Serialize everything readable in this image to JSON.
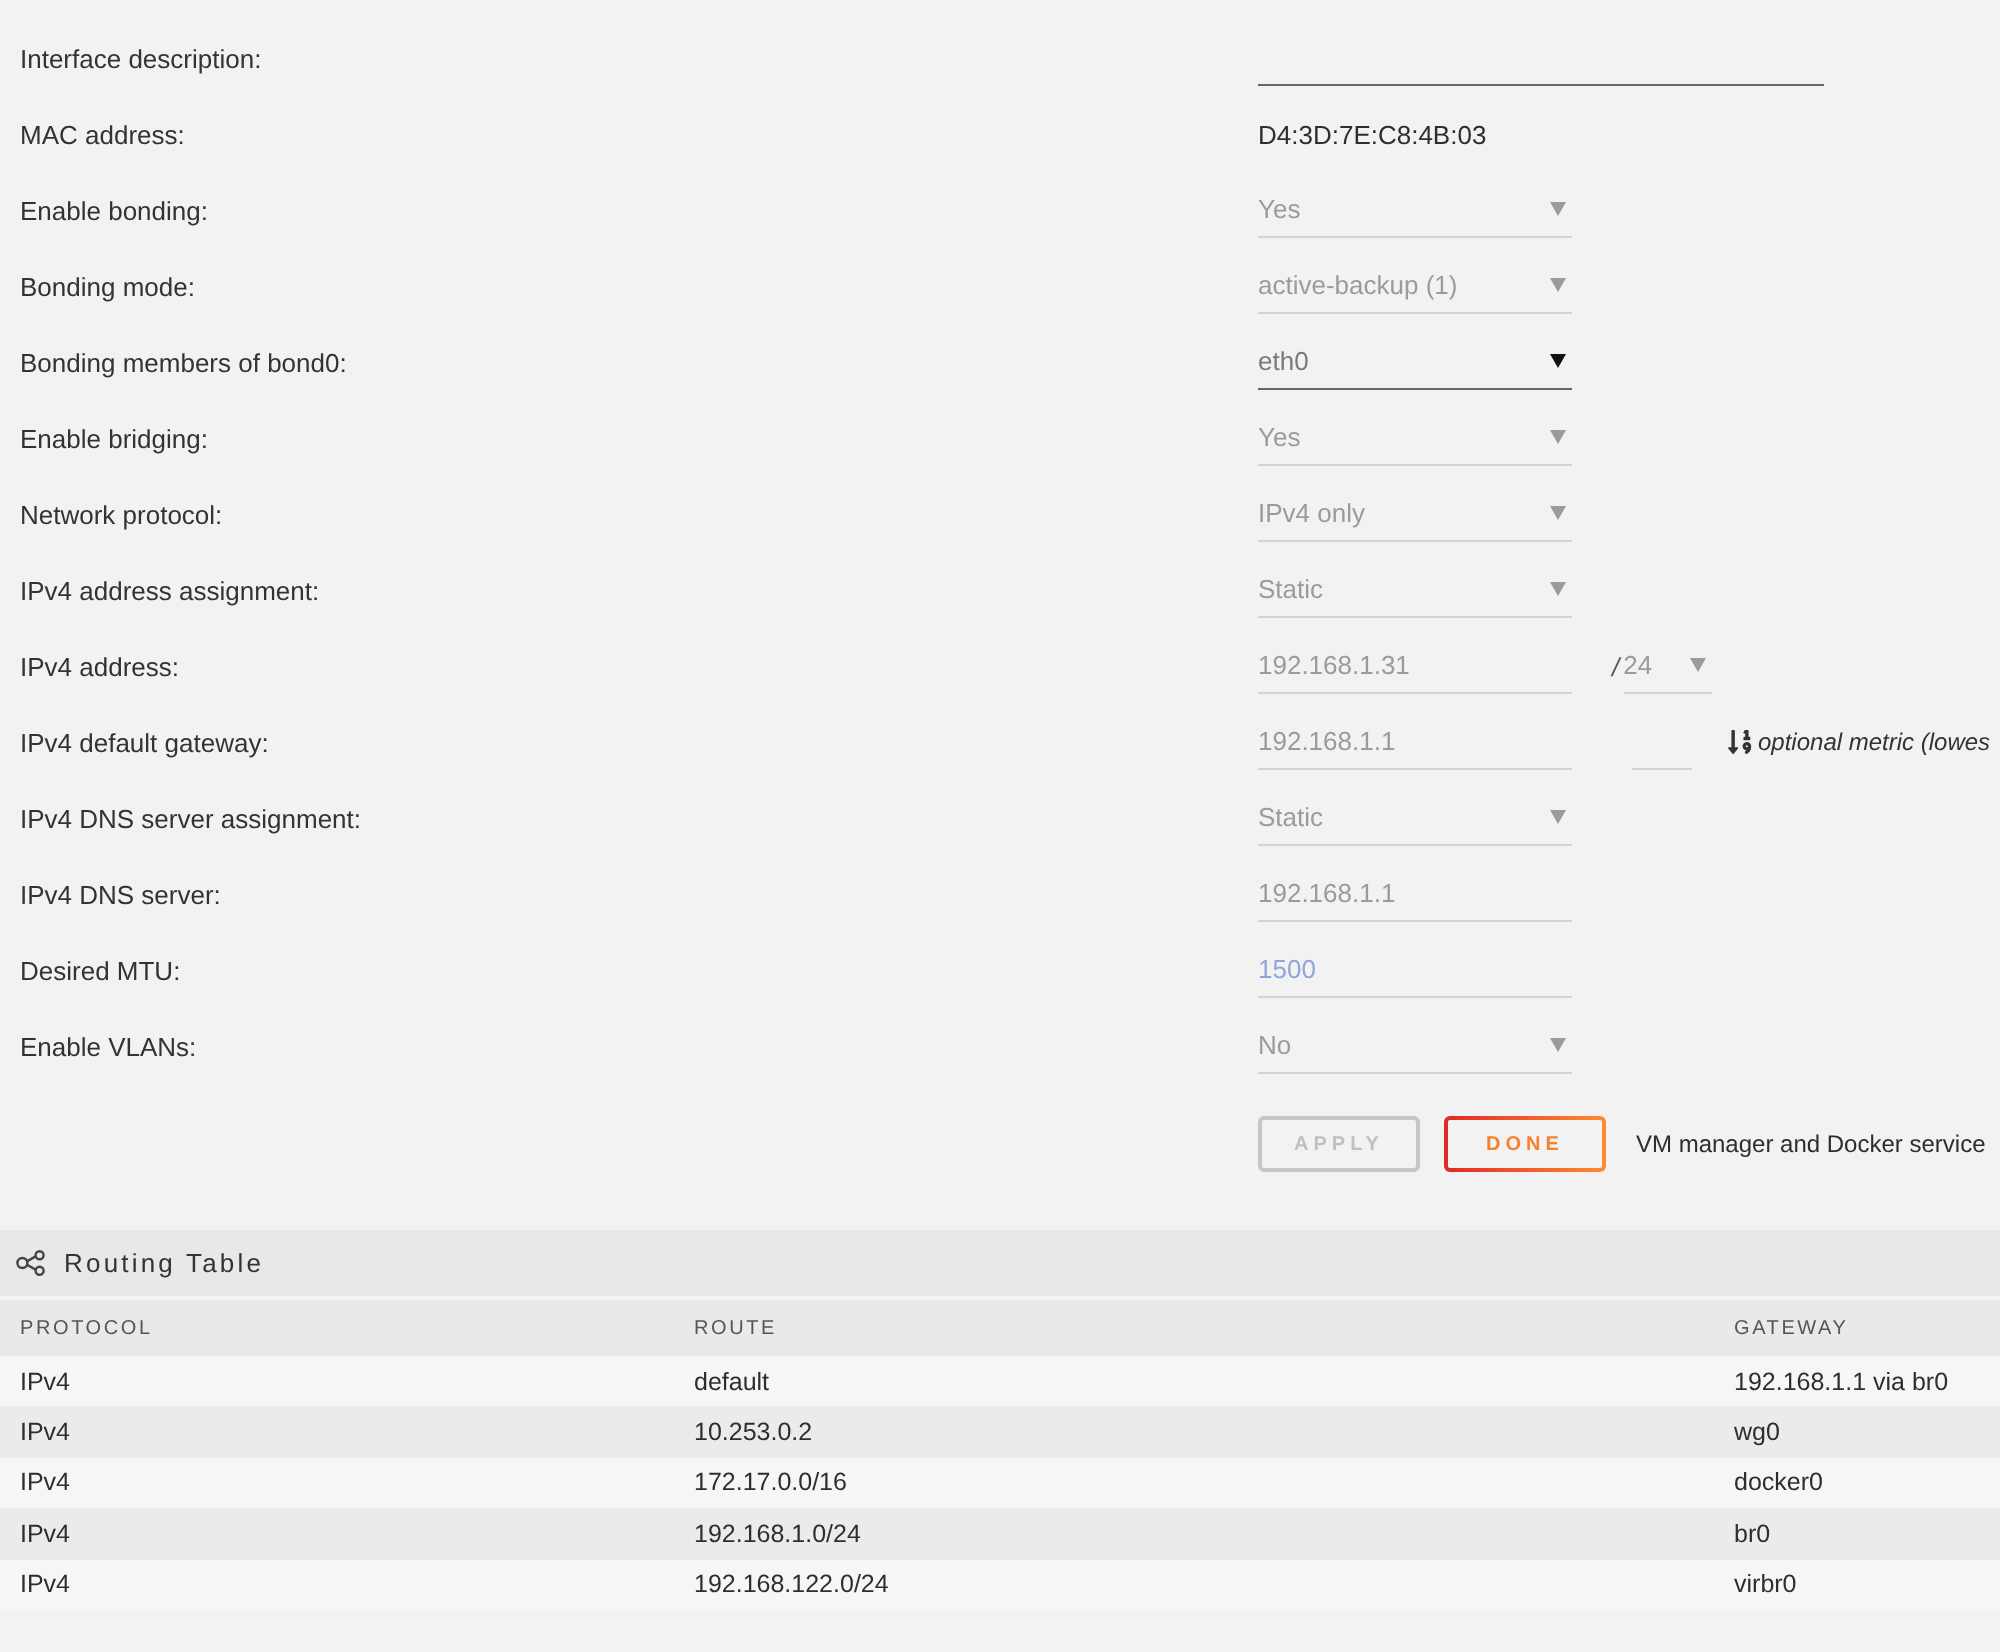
{
  "form": {
    "fields": [
      {
        "label": "Interface description:",
        "controls": [
          {
            "kind": "wide_text",
            "disabled": false
          }
        ]
      },
      {
        "label": "MAC address:",
        "controls": [
          {
            "kind": "static",
            "value": "D4:3D:7E:C8:4B:03"
          }
        ]
      },
      {
        "label": "Enable bonding:",
        "controls": [
          {
            "kind": "select",
            "value": "Yes",
            "disabled": true
          }
        ]
      },
      {
        "label": "Bonding mode:",
        "controls": [
          {
            "kind": "select",
            "value": "active-backup (1)",
            "disabled": true
          }
        ]
      },
      {
        "label": "Bonding members of bond0:",
        "controls": [
          {
            "kind": "select",
            "value": "eth0",
            "disabled": false
          }
        ]
      },
      {
        "label": "Enable bridging:",
        "controls": [
          {
            "kind": "select",
            "value": "Yes",
            "disabled": true
          }
        ]
      },
      {
        "label": "Network protocol:",
        "controls": [
          {
            "kind": "select",
            "value": "IPv4 only",
            "disabled": true
          }
        ]
      },
      {
        "label": "IPv4 address assignment:",
        "controls": [
          {
            "kind": "select",
            "value": "Static",
            "disabled": true
          }
        ]
      },
      {
        "label": "IPv4 address:",
        "controls": [
          {
            "kind": "text",
            "value": "192.168.1.31",
            "disabled": true
          },
          {
            "kind": "separator",
            "value": "/"
          },
          {
            "kind": "short_select",
            "value": "24",
            "disabled": true
          }
        ]
      },
      {
        "label": "IPv4 default gateway:",
        "controls": [
          {
            "kind": "text",
            "value": "192.168.1.1",
            "disabled": true
          },
          {
            "kind": "short_text",
            "disabled": true
          },
          {
            "kind": "hint",
            "value": "optional metric (lowes"
          }
        ]
      },
      {
        "label": "IPv4 DNS server assignment:",
        "controls": [
          {
            "kind": "select",
            "value": "Static",
            "disabled": true
          }
        ]
      },
      {
        "label": "IPv4 DNS server:",
        "controls": [
          {
            "kind": "text",
            "value": "192.168.1.1",
            "disabled": true
          }
        ]
      },
      {
        "label": "Desired MTU:",
        "controls": [
          {
            "kind": "text",
            "placeholder": "1500",
            "disabled": true
          }
        ]
      },
      {
        "label": "Enable VLANs:",
        "controls": [
          {
            "kind": "select",
            "value": "No",
            "disabled": true
          }
        ]
      }
    ],
    "buttons": [
      {
        "label": "APPLY",
        "kind": "secondary",
        "disabled": true
      },
      {
        "label": "DONE",
        "kind": "primary",
        "disabled": false
      }
    ],
    "note": "VM manager and Docker service"
  },
  "routing_table": {
    "title": "Routing Table",
    "columns": [
      "PROTOCOL",
      "ROUTE",
      "GATEWAY"
    ],
    "rows": [
      [
        "IPv4",
        "default",
        "192.168.1.1 via br0"
      ],
      [
        "IPv4",
        "10.253.0.2",
        "wg0"
      ],
      [
        "IPv4",
        "172.17.0.0/16",
        "docker0"
      ],
      [
        "IPv4",
        "192.168.1.0/24",
        "br0"
      ],
      [
        "IPv4",
        "192.168.122.0/24",
        "virbr0"
      ]
    ]
  }
}
